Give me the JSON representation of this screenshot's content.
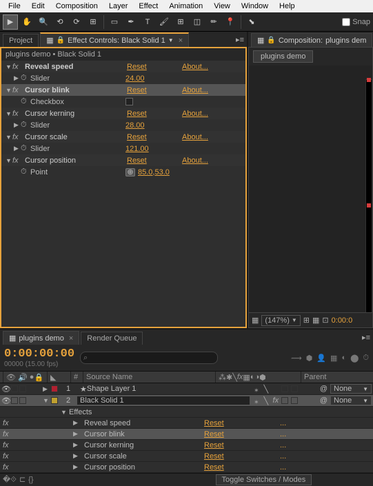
{
  "menu": [
    "File",
    "Edit",
    "Composition",
    "Layer",
    "Effect",
    "Animation",
    "View",
    "Window",
    "Help"
  ],
  "snap_label": "Snap",
  "tabs": {
    "project": "Project",
    "effect_controls": "Effect Controls: Black Solid 1",
    "comp_panel_prefix": "Composition:",
    "comp_panel_name": "plugins dem"
  },
  "ec": {
    "breadcrumb_comp": "plugins demo",
    "breadcrumb_layer": "Black Solid 1",
    "reset": "Reset",
    "about": "About...",
    "effects": [
      {
        "name": "Reveal speed",
        "bold": true,
        "sel": false,
        "props": [
          {
            "name": "Slider",
            "type": "slider",
            "value": "24.00"
          }
        ]
      },
      {
        "name": "Cursor blink",
        "bold": true,
        "sel": true,
        "props": [
          {
            "name": "Checkbox",
            "type": "checkbox"
          }
        ]
      },
      {
        "name": "Cursor kerning",
        "bold": false,
        "sel": false,
        "props": [
          {
            "name": "Slider",
            "type": "slider",
            "value": "28.00"
          }
        ]
      },
      {
        "name": "Cursor scale",
        "bold": false,
        "sel": false,
        "props": [
          {
            "name": "Slider",
            "type": "slider",
            "value": "121.00"
          }
        ]
      },
      {
        "name": "Cursor position",
        "bold": false,
        "sel": false,
        "props": [
          {
            "name": "Point",
            "type": "point",
            "value": "85.0,53.0"
          }
        ]
      }
    ]
  },
  "comp": {
    "tab": "plugins demo",
    "zoom": "(147%)",
    "time": "0:00:0"
  },
  "timeline": {
    "tab": "plugins demo",
    "render_tab": "Render Queue",
    "timecode": "0:00:00:00",
    "timecode_sub": "00000 (15.00 fps)",
    "col_num": "#",
    "col_src": "Source Name",
    "col_parent": "Parent",
    "parent_none": "None",
    "layers": [
      {
        "num": "1",
        "name": "Shape Layer 1",
        "star": true,
        "color": "clr-red",
        "sel": false
      },
      {
        "num": "2",
        "name": "Black Solid 1",
        "star": false,
        "color": "clr-yel",
        "sel": true
      }
    ],
    "effects_label": "Effects",
    "fx": [
      {
        "name": "Reveal speed",
        "sel": false
      },
      {
        "name": "Cursor blink",
        "sel": true
      },
      {
        "name": "Cursor kerning",
        "sel": false
      },
      {
        "name": "Cursor scale",
        "sel": false
      },
      {
        "name": "Cursor position",
        "sel": false
      }
    ],
    "reset": "Reset",
    "dots": "..."
  },
  "status": {
    "toggle": "Toggle Switches / Modes"
  }
}
